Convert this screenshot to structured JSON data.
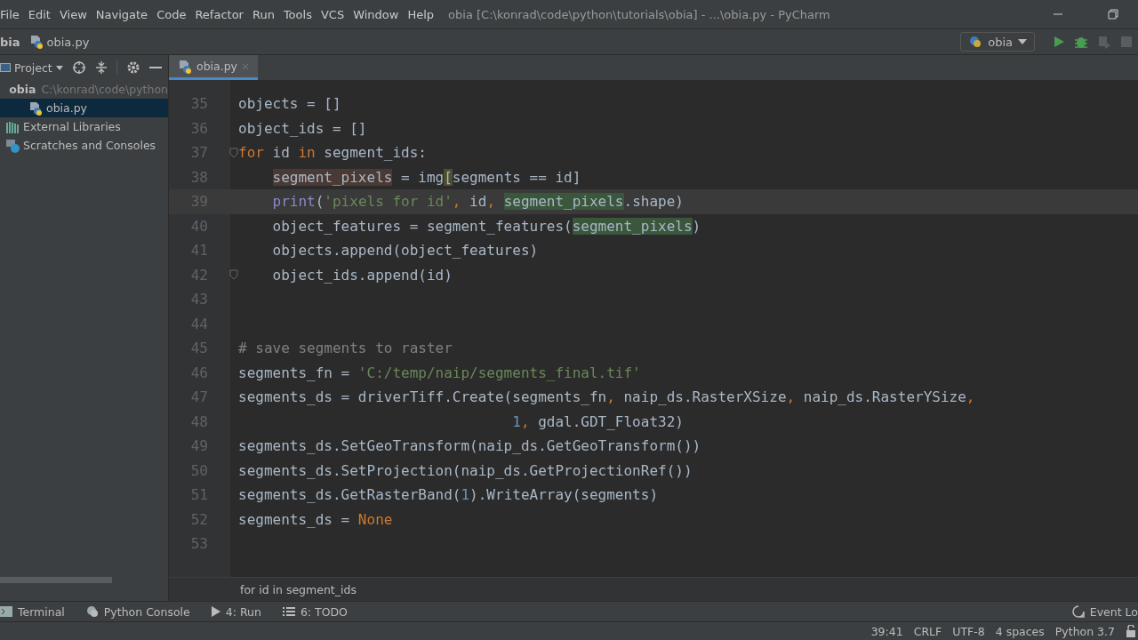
{
  "menu": [
    "File",
    "Edit",
    "View",
    "Navigate",
    "Code",
    "Refactor",
    "Run",
    "Tools",
    "VCS",
    "Window",
    "Help"
  ],
  "window": {
    "title": "obia [C:\\konrad\\code\\python\\tutorials\\obia] - ...\\obia.py - PyCharm"
  },
  "breadcrumbs": [
    "bia",
    "obia.py"
  ],
  "run_config": "obia",
  "project_panel": {
    "title": "Project",
    "tree": [
      {
        "name": "obia",
        "path": "C:\\konrad\\code\\python",
        "kind": "folder",
        "selected": false,
        "children": [
          {
            "name": "obia.py",
            "kind": "file",
            "selected": true
          }
        ]
      },
      {
        "name": "External Libraries",
        "kind": "libs",
        "selected": false
      },
      {
        "name": "Scratches and Consoles",
        "kind": "scratch",
        "selected": false
      }
    ]
  },
  "tabs": [
    {
      "label": "obia.py",
      "selected": true
    }
  ],
  "code": [
    {
      "n": "35",
      "current": false,
      "tokens": [
        {
          "kind": "plain",
          "text": "objects = []"
        }
      ]
    },
    {
      "n": "36",
      "current": false,
      "tokens": [
        {
          "kind": "plain",
          "text": "object_ids = []"
        }
      ]
    },
    {
      "n": "37",
      "current": false,
      "fold": true,
      "tokens": [
        {
          "kind": "keyword",
          "text": "for"
        },
        {
          "kind": "plain",
          "text": " id "
        },
        {
          "kind": "keyword",
          "text": "in"
        },
        {
          "kind": "plain",
          "text": " segment_ids:"
        }
      ]
    },
    {
      "n": "38",
      "current": false,
      "indented": true,
      "tokens": [
        {
          "kind": "plain",
          "text": "segment_pixels",
          "write_highlight": true
        },
        {
          "kind": "plain",
          "text": " = img"
        },
        {
          "kind": "plain",
          "text": "[",
          "brace_match": true
        },
        {
          "kind": "plain",
          "text": "segments == id]"
        }
      ]
    },
    {
      "n": "39",
      "current": true,
      "indented": true,
      "tokens": [
        {
          "kind": "builtin",
          "text": "print"
        },
        {
          "kind": "plain",
          "text": "("
        },
        {
          "kind": "string",
          "text": "'pixels for id'"
        },
        {
          "kind": "keyword",
          "text": ", "
        },
        {
          "kind": "plain",
          "text": "id"
        },
        {
          "kind": "keyword",
          "text": ", "
        },
        {
          "kind": "plain",
          "text": "segment_pixels",
          "read_highlight": true
        },
        {
          "kind": "plain",
          "text": ".shape)"
        }
      ]
    },
    {
      "n": "40",
      "current": false,
      "indented": true,
      "tokens": [
        {
          "kind": "plain",
          "text": "object_features = segment_features("
        },
        {
          "kind": "plain",
          "text": "segment_pixels",
          "read_highlight": true
        },
        {
          "kind": "plain",
          "text": ")"
        }
      ]
    },
    {
      "n": "41",
      "current": false,
      "indented": true,
      "tokens": [
        {
          "kind": "plain",
          "text": "objects.append(object_features)"
        }
      ]
    },
    {
      "n": "42",
      "current": false,
      "indented": true,
      "fold": true,
      "tokens": [
        {
          "kind": "plain",
          "text": "object_ids.append(id)"
        }
      ]
    },
    {
      "n": "43",
      "current": false
    },
    {
      "n": "44",
      "current": false
    },
    {
      "n": "45",
      "current": false,
      "tokens": [
        {
          "kind": "comment",
          "text": "# save segments to raster"
        }
      ]
    },
    {
      "n": "46",
      "current": false,
      "tokens": [
        {
          "kind": "plain",
          "text": "segments_fn = "
        },
        {
          "kind": "string",
          "text": "'C:/temp/naip/segments_final.tif'"
        }
      ]
    },
    {
      "n": "47",
      "current": false,
      "tokens": [
        {
          "kind": "plain",
          "text": "segments_ds = driverTiff.Create(segments_fn"
        },
        {
          "kind": "keyword",
          "text": ", "
        },
        {
          "kind": "plain",
          "text": "naip_ds.RasterXSize"
        },
        {
          "kind": "keyword",
          "text": ", "
        },
        {
          "kind": "plain",
          "text": "naip_ds.RasterYSize"
        },
        {
          "kind": "keyword",
          "text": ","
        }
      ]
    },
    {
      "n": "48",
      "current": false,
      "continuation_indent": true,
      "tokens": [
        {
          "kind": "number",
          "text": "1"
        },
        {
          "kind": "keyword",
          "text": ", "
        },
        {
          "kind": "plain",
          "text": "gdal.GDT_Float32)"
        }
      ]
    },
    {
      "n": "49",
      "current": false,
      "tokens": [
        {
          "kind": "plain",
          "text": "segments_ds.SetGeoTransform(naip_ds.GetGeoTransform())"
        }
      ]
    },
    {
      "n": "50",
      "current": false,
      "tokens": [
        {
          "kind": "plain",
          "text": "segments_ds.SetProjection(naip_ds.GetProjectionRef())"
        }
      ]
    },
    {
      "n": "51",
      "current": false,
      "tokens": [
        {
          "kind": "plain",
          "text": "segments_ds.GetRasterBand("
        },
        {
          "kind": "number",
          "text": "1"
        },
        {
          "kind": "plain",
          "text": ").WriteArray(segments)"
        }
      ]
    },
    {
      "n": "52",
      "current": false,
      "tokens": [
        {
          "kind": "plain",
          "text": "segments_ds = "
        },
        {
          "kind": "keyword",
          "text": "None"
        }
      ]
    },
    {
      "n": "53",
      "current": false
    }
  ],
  "editor_breadcrumb": "for id in segment_ids",
  "tool_windows": [
    {
      "label": "Terminal",
      "kind": "terminal"
    },
    {
      "label": "Python Console",
      "kind": "python"
    },
    {
      "label": "4: Run",
      "kind": "run"
    },
    {
      "label": "6: TODO",
      "kind": "todo"
    }
  ],
  "event_log": "Event Lo",
  "status": [
    "39:41",
    "CRLF",
    "UTF-8",
    "4 spaces",
    "Python 3.7"
  ]
}
